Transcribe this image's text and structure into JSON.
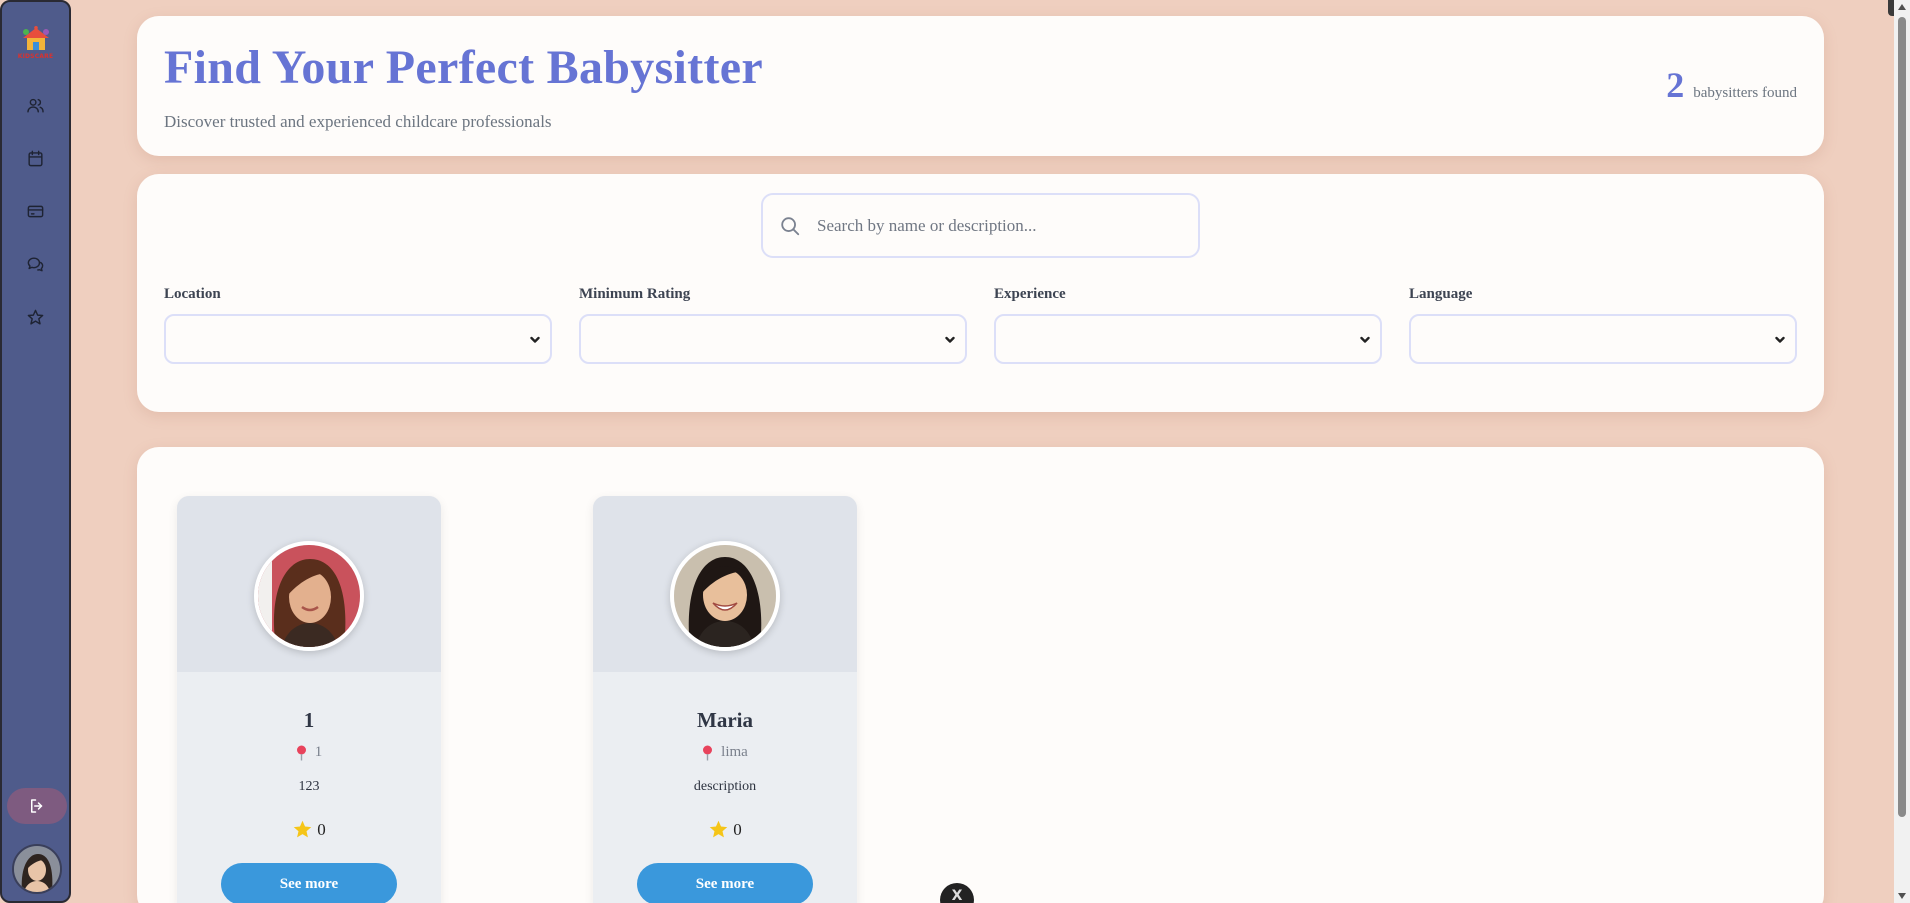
{
  "sidebar": {
    "logo_text": "KIDSCARE",
    "nav_items": [
      {
        "icon": "users-icon"
      },
      {
        "icon": "calendar-icon"
      },
      {
        "icon": "credit-card-icon"
      },
      {
        "icon": "chat-icon"
      },
      {
        "icon": "star-icon"
      }
    ],
    "logout_icon": "logout-icon"
  },
  "header": {
    "title": "Find Your Perfect Babysitter",
    "subtitle": "Discover trusted and experienced childcare professionals",
    "count": "2",
    "count_label": "babysitters found"
  },
  "filters": {
    "search_placeholder": "Search by name or description...",
    "location_label": "Location",
    "rating_label": "Minimum Rating",
    "experience_label": "Experience",
    "language_label": "Language"
  },
  "sitters": [
    {
      "name": "1",
      "location": "1",
      "description": "123",
      "rating": "0",
      "button": "See more"
    },
    {
      "name": "Maria",
      "location": "lima",
      "description": "description",
      "rating": "0",
      "button": "See more"
    }
  ],
  "floating_close_label": "X",
  "colors": {
    "accent": "#6674d4",
    "sidebar": "#4f5b8b",
    "page_bg": "#efcfbf",
    "button": "#3a98dc",
    "star": "#f5c518",
    "pin": "#e8435c"
  }
}
